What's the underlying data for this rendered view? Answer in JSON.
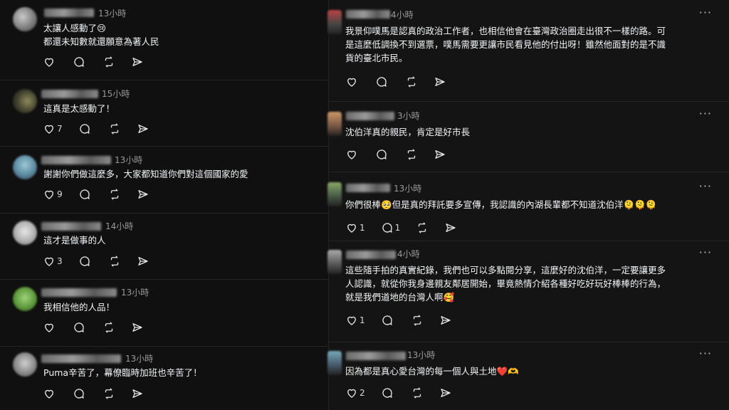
{
  "left_posts": [
    {
      "time": "13小時",
      "text": "太讓人感動了😢\n都還未知數就還願意為著人民",
      "likes": "",
      "replies": ""
    },
    {
      "time": "15小時",
      "text": "這真是太感動了！",
      "likes": "7",
      "replies": ""
    },
    {
      "time": "13小時",
      "text": "謝謝你們做這麼多，大家都知道你們對這個國家的愛",
      "likes": "9",
      "replies": ""
    },
    {
      "time": "14小時",
      "text": "這才是做事的人",
      "likes": "3",
      "replies": ""
    },
    {
      "time": "13小時",
      "text": "我相信他的人品！",
      "likes": "",
      "replies": ""
    },
    {
      "time": "13小時",
      "text": "Puma辛苦了，幕僚臨時加班也辛苦了！",
      "likes": "",
      "replies": ""
    }
  ],
  "right_posts": [
    {
      "time": "4小時",
      "text": "我景仰噗馬是認真的政治工作者，也相信他會在臺灣政治圈走出很不一樣的路。可\n是這麼低調換不到選票，噗馬需要更讓市民看見他的付出呀！雖然他面對的是不識\n貨的臺北市民。",
      "likes": "",
      "replies": "",
      "more": "···"
    },
    {
      "time": "3小時",
      "text": "沈伯洋真的親民，肯定是好市長",
      "likes": "",
      "replies": "",
      "more": "···"
    },
    {
      "time": "13小時",
      "text": "你們很棒🥺但是真的拜託要多宣傳，我認識的內湖長輩都不知道沈伯洋🫠🫠🫠",
      "likes": "1",
      "replies": "1",
      "more": "···"
    },
    {
      "time": "4小時",
      "text": "這些隨手拍的真實紀錄，我們也可以多點閱分享，這麼好的沈伯洋，一定要讓更多\n人認識，就從你我身邊親友鄰居開始，畢竟熱情介紹各種好吃好玩好棒棒的行為，\n就是我們道地的台灣人啊🥰",
      "likes": "1",
      "replies": "",
      "more": "···"
    },
    {
      "time": "13小時",
      "text": "因為都是真心愛台灣的每一個人與土地❤️🫶",
      "likes": "2",
      "replies": "",
      "more": "···"
    }
  ],
  "icons": {
    "like": "heart-icon",
    "reply": "comment-icon",
    "repost": "repost-icon",
    "share": "share-icon"
  }
}
